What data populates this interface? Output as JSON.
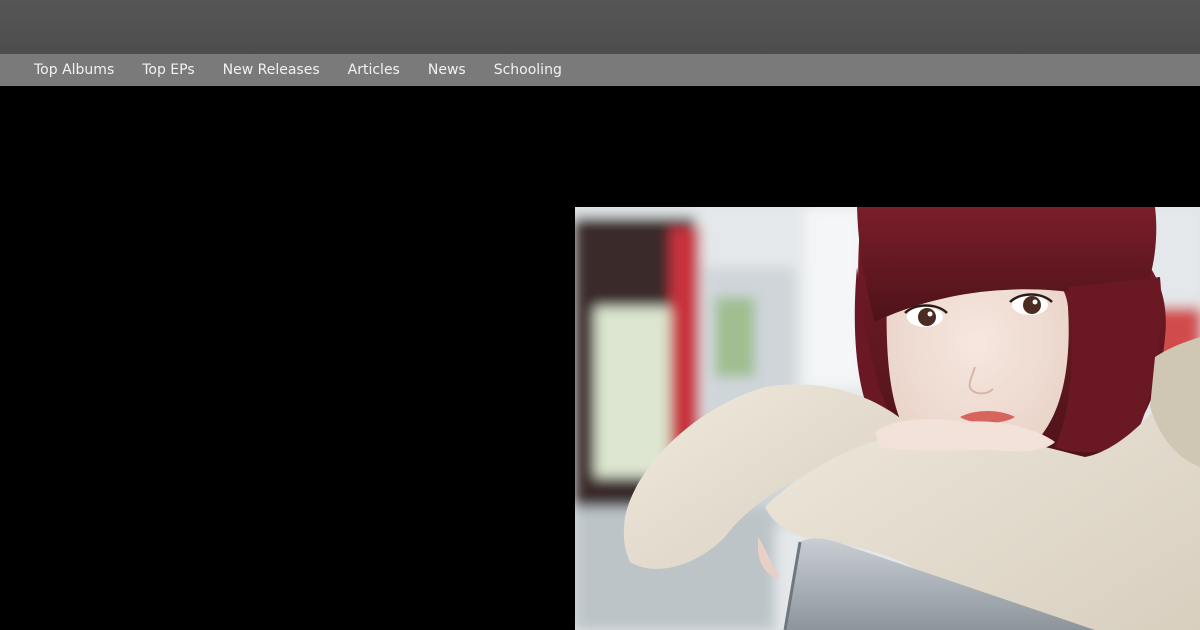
{
  "nav": {
    "items": [
      {
        "label": "Top Albums"
      },
      {
        "label": "Top EPs"
      },
      {
        "label": "New Releases"
      },
      {
        "label": "Articles"
      },
      {
        "label": "News"
      },
      {
        "label": "Schooling"
      }
    ]
  },
  "colors": {
    "header_bg": "#515151",
    "nav_bg": "#7a7a7a",
    "page_bg": "#000000",
    "nav_text": "#f2f2f2"
  },
  "hero_image": {
    "subject": "portrait-photo"
  }
}
